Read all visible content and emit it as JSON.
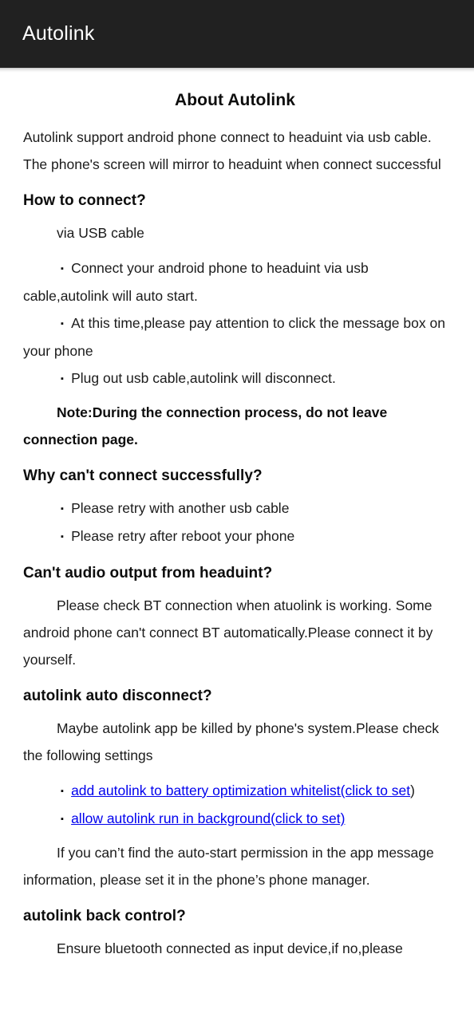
{
  "appbar": {
    "title": "Autolink"
  },
  "page": {
    "title": "About Autolink",
    "intro": "Autolink support android phone connect to headuint via usb cable. The phone's screen will mirror to headuint when connect successful"
  },
  "sections": [
    {
      "heading": "How to connect?",
      "lead": "via USB cable",
      "bullets": [
        "Connect your android phone to headuint via usb cable,autolink will auto start.",
        "At this time,please pay attention to click the message box on your phone",
        "Plug out usb cable,autolink will disconnect."
      ],
      "note": "Note:During the connection process, do not leave connection page."
    },
    {
      "heading": "Why can't connect successfully?",
      "bullets": [
        "Please retry with another usb cable",
        "Please retry after reboot your phone"
      ]
    },
    {
      "heading": "Can't audio output from headuint?",
      "paragraph": "Please check BT connection when atuolink is working. Some android phone can't connect BT automatically.Please connect it by yourself."
    },
    {
      "heading": "autolink auto disconnect?",
      "paragraph": "Maybe autolink app be killed by phone's system.Please check the following settings",
      "links": [
        {
          "text": "add autolink to battery optimization whitelist(click to set",
          "tail": ")"
        },
        {
          "text": "allow autolink run in background(click to set)",
          "tail": ""
        }
      ],
      "footnote": "If you can’t find the auto-start permission in the app message information, please set it in the phone’s phone manager."
    },
    {
      "heading": "autolink back control?",
      "paragraph": "Ensure bluetooth connected as input device,if no,please"
    }
  ],
  "icons": {
    "bullet": "▪"
  },
  "colors": {
    "appbar_background": "#212121",
    "appbar_text": "#ffffff",
    "body_text": "#1b1b1b",
    "link": "#0000ee",
    "page_background": "#ffffff"
  }
}
